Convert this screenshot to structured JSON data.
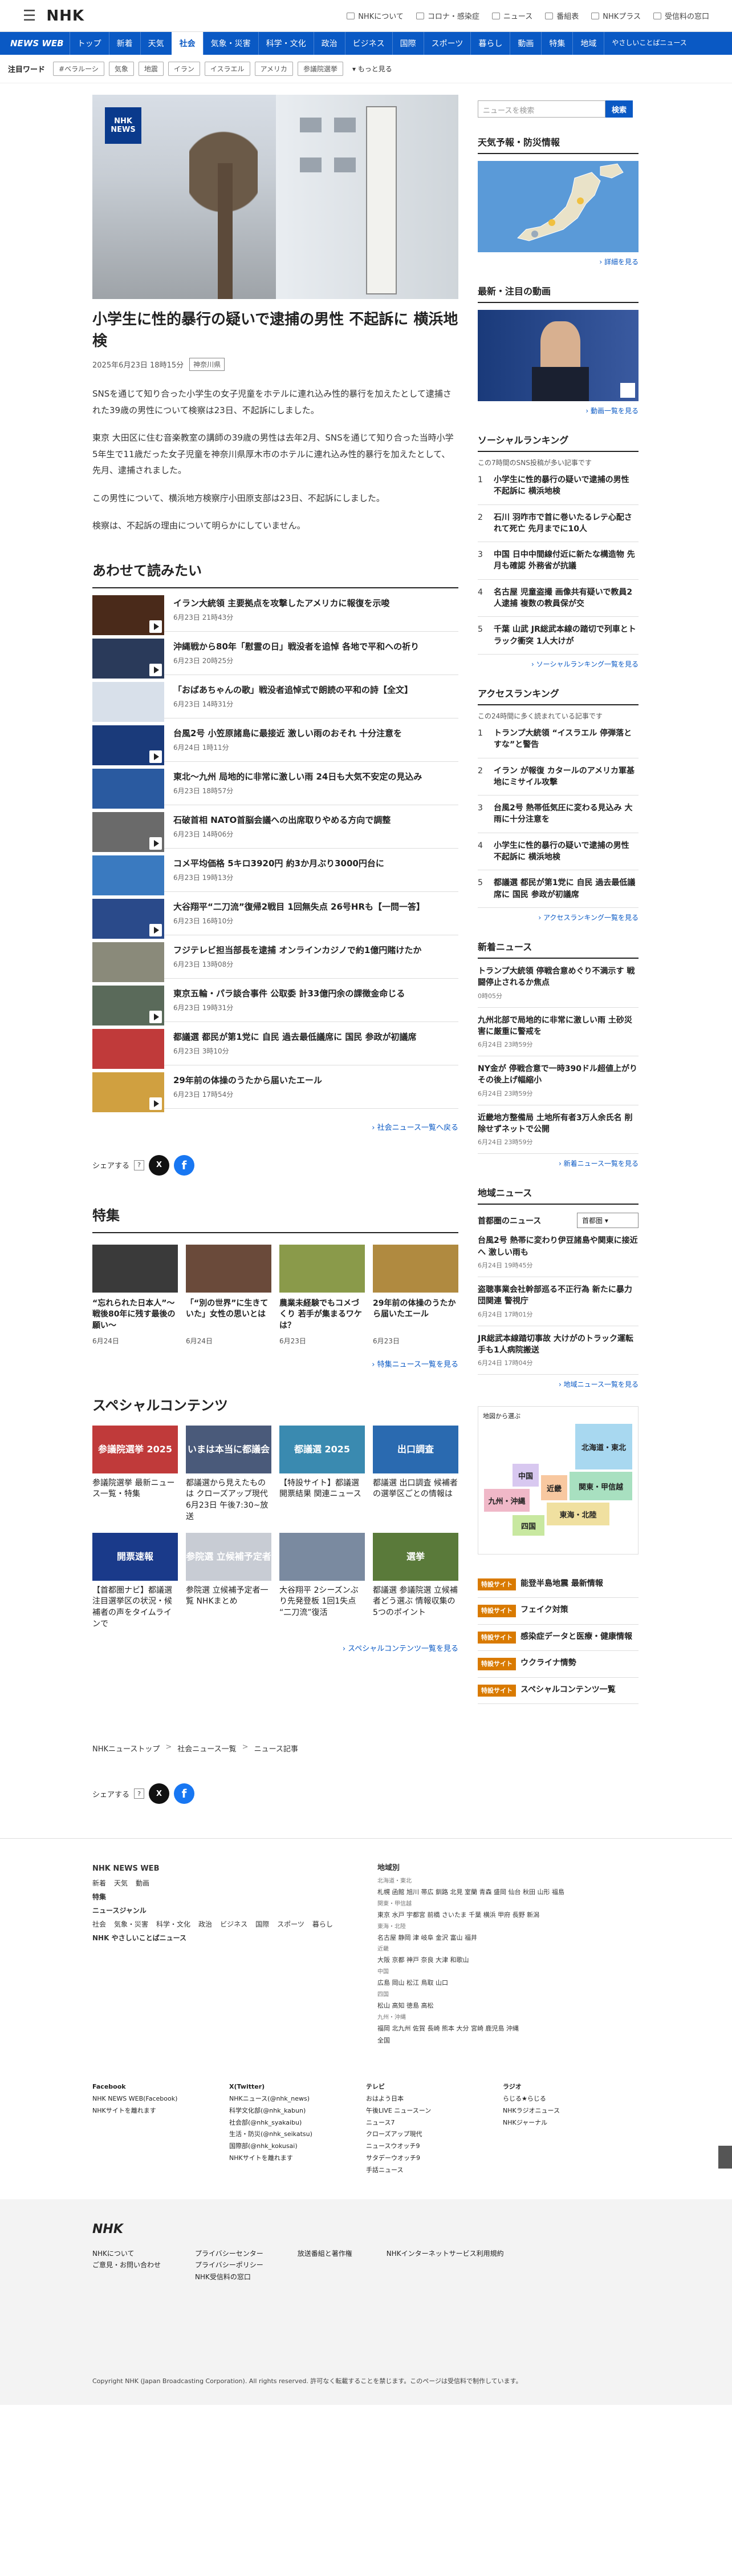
{
  "header": {
    "logo": "NHK",
    "links": [
      "NHKについて",
      "コロナ・感染症",
      "ニュース",
      "番組表",
      "NHKプラス",
      "受信料の窓口"
    ]
  },
  "nav": {
    "brand": "NEWS WEB",
    "items": [
      "トップ",
      "新着",
      "天気",
      "社会",
      "気象・災害",
      "科学・文化",
      "政治",
      "ビジネス",
      "国際",
      "スポーツ",
      "暮らし",
      "動画",
      "特集",
      "地域"
    ],
    "easy": "やさしいことばニュース",
    "active": "社会"
  },
  "trend": {
    "label": "注目ワード",
    "tags": [
      "#ベラルーシ",
      "気象",
      "地震",
      "イラン",
      "イスラエル",
      "アメリカ",
      "参議院選挙"
    ],
    "more": "もっと見る"
  },
  "article": {
    "badge": [
      "NHK",
      "NEWS"
    ],
    "title": "小学生に性的暴行の疑いで逮捕の男性 不起訴に 横浜地検",
    "date": "2025年6月23日 18時15分",
    "chip": "神奈川県",
    "paragraphs": [
      "SNSを通じて知り合った小学生の女子児童をホテルに連れ込み性的暴行を加えたとして逮捕された39歳の男性について検察は23日、不起訴にしました。",
      "東京 大田区に住む音楽教室の講師の39歳の男性は去年2月、SNSを通じて知り合った当時小学5年生で11歳だった女子児童を神奈川県厚木市のホテルに連れ込み性的暴行を加えたとして、先月、逮捕されました。",
      "この男性について、横浜地方検察庁小田原支部は23日、不起訴にしました。",
      "検察は、不起訴の理由について明らかにしていません。"
    ]
  },
  "related": {
    "heading": "あわせて読みたい",
    "items": [
      {
        "t": "イラン大統領 主要拠点を攻撃したアメリカに報復を示唆",
        "d": "6月23日 21時43分",
        "c": "#4a2a1a"
      },
      {
        "t": "沖縄戦から80年「慰霊の日」戦没者を追悼 各地で平和への祈り",
        "d": "6月23日 20時25分",
        "c": "#2a3a5a"
      },
      {
        "t": "「おばあちゃんの歌」戦没者追悼式で朗読の平和の詩【全文】",
        "d": "6月23日 14時31分",
        "c": "#d8e0ea"
      },
      {
        "t": "台風2号 小笠原諸島に最接近 激しい雨のおそれ 十分注意を",
        "d": "6月24日 1時11分",
        "c": "#1a3a7a"
      },
      {
        "t": "東北～九州 局地的に非常に激しい雨 24日も大気不安定の見込み",
        "d": "6月23日 18時57分",
        "c": "#2a5aa0"
      },
      {
        "t": "石破首相 NATO首脳会議への出席取りやめる方向で調整",
        "d": "6月23日 14時06分",
        "c": "#6a6a6a"
      },
      {
        "t": "コメ平均価格 5キロ3920円 約3か月ぶり3000円台に",
        "d": "6月23日 19時13分",
        "c": "#3a7ac0"
      },
      {
        "t": "大谷翔平“二刀流”復帰2戦目 1回無失点 26号HRも【一問一答】",
        "d": "6月23日 16時10分",
        "c": "#2a4a8a"
      },
      {
        "t": "フジテレビ担当部長を逮捕 オンラインカジノで約1億円賭けたか",
        "d": "6月23日 13時08分",
        "c": "#8a8a7a"
      },
      {
        "t": "東京五輪・パラ談合事件 公取委 計33億円余の課徴金命じる",
        "d": "6月23日 19時31分",
        "c": "#5a6a5a"
      },
      {
        "t": "都議選 都民が第1党に 自民 過去最低議席に 国民 参政が初議席",
        "d": "6月23日 3時10分",
        "c": "#c03a3a"
      },
      {
        "t": "29年前の体操のうたから届いたエール",
        "d": "6月23日 17時54分",
        "c": "#d0a040"
      }
    ],
    "more": "社会ニュース一覧へ戻る"
  },
  "share": {
    "label": "シェアする",
    "x": "X",
    "fb": "f"
  },
  "features": {
    "heading": "特集",
    "items": [
      {
        "t": "“忘れられた日本人”〜戦後80年に残す最後の願い〜",
        "d": "6月24日",
        "c": "#3a3a3a"
      },
      {
        "t": "「“別の世界”に生きていた」女性の思いとは",
        "d": "6月24日",
        "c": "#6a4a3a"
      },
      {
        "t": "農業未経験でもコメづくり 若手が集まるワケは？",
        "d": "6月23日",
        "c": "#8a9a4a"
      },
      {
        "t": "29年前の体操のうたから届いたエール",
        "d": "6月23日",
        "c": "#b08a40"
      }
    ],
    "more": "特集ニュース一覧を見る"
  },
  "special": {
    "heading": "スペシャルコンテンツ",
    "items": [
      {
        "t": "参議院選挙 最新ニュース一覧・特集",
        "img": "参議院選挙 2025",
        "c": "#c03a3a"
      },
      {
        "t": "都議選から見えたものは クローズアップ現代 6月23日 午後7:30~放送",
        "img": "いまは本当に都議会",
        "c": "#4a5a7a"
      },
      {
        "t": "【特設サイト】都議選 開票結果 関連ニュース",
        "img": "都議選 2025",
        "c": "#3a8ab0"
      },
      {
        "t": "都議選 出口調査 候補者の選挙区ごとの情報は",
        "img": "出口調査",
        "c": "#2a6ab0"
      },
      {
        "t": "【首都圏ナビ】都議選 注目選挙区の状況・候補者の声をタイムラインで",
        "img": "開票速報",
        "c": "#1a3a8a"
      },
      {
        "t": "参院選 立候補予定者一覧 NHKまとめ",
        "img": "参院選 立候補予定者",
        "c": "#c8ccd4"
      },
      {
        "t": "大谷翔平 2シーズンぶり先発登板 1回1失点 “二刀流”復活",
        "img": "",
        "c": "#7a8aa0"
      },
      {
        "t": "都議選 参議院選 立候補者どう選ぶ 情報収集の5つのポイント",
        "img": "選挙",
        "c": "#5a7a3a"
      }
    ],
    "more": "スペシャルコンテンツ一覧を見る"
  },
  "sidebar": {
    "search_placeholder": "ニュースを検索",
    "search_btn": "検索",
    "weather": {
      "h": "天気予報・防災情報",
      "more": "詳細を見る"
    },
    "video": {
      "h": "最新・注目の動画",
      "more": "動画一覧を見る"
    },
    "social": {
      "h": "ソーシャルランキング",
      "note": "この7時間のSNS投稿が多い記事です",
      "items": [
        "小学生に性的暴行の疑いで逮捕の男性 不起訴に 横浜地検",
        "石川 羽咋市で首に巻いたるレテ心配されて死亡 先月までに10人",
        "中国 日中中間線付近に新たな構造物 先月も確認 外務省が抗議",
        "名古屋 児童盗撮 画像共有疑いで教員2人逮捕 複数の教員保が交",
        "千葉 山武 JR総武本線の踏切で列車とトラック衝突 1人大けが"
      ],
      "more": "ソーシャルランキング一覧を見る"
    },
    "access": {
      "h": "アクセスランキング",
      "note": "この24時間に多く読まれている記事です",
      "items": [
        "トランプ大統領 “イスラエル 停弾落とすな”と警告",
        "イラン が報復 カタールのアメリカ軍基地にミサイル攻撃",
        "台風2号 熱帯低気圧に変わる見込み 大雨に十分注意を",
        "小学生に性的暴行の疑いで逮捕の男性 不起訴に 横浜地検",
        "都議選 都民が第1党に 自民 過去最低議席に 国民 参政が初議席"
      ],
      "more": "アクセスランキング一覧を見る"
    },
    "latest": {
      "h": "新着ニュース",
      "items": [
        {
          "t": "トランプ大統領 停戦合意めぐり不満示す 戦闘停止されるか焦点",
          "d": "0時05分"
        },
        {
          "t": "九州北部で局地的に非常に激しい雨 土砂災害に厳重に警戒を",
          "d": "6月24日 23時59分"
        },
        {
          "t": "NY金が 停戦合意で一時390ドル超値上がり その後上げ幅縮小",
          "d": "6月24日 23時59分"
        },
        {
          "t": "近畿地方整備局 土地所有者3万人余氏名 削除せずネットで公開",
          "d": "6月24日 23時59分"
        }
      ],
      "more": "新着ニュース一覧を見る"
    },
    "regional": {
      "h": "地域ニュース",
      "label": "首都圏のニュース",
      "select": "首都圏",
      "items": [
        {
          "t": "台風2号 熱帯に変わり伊豆諸島や関東に接近へ 激しい雨も",
          "d": "6月24日 19時45分"
        },
        {
          "t": "盗聴事業会社幹部巡る不正行為 新たに暴力団関連 警視庁",
          "d": "6月24日 17時01分"
        },
        {
          "t": "JR総武本線踏切事故 大けがのトラック運転手も1人病院搬送",
          "d": "6月24日 17時04分"
        }
      ],
      "more": "地域ニュース一覧を見る"
    },
    "map": {
      "h": "地図から選ぶ",
      "regions": [
        "北海道・東北",
        "関東・甲信越",
        "東海・北陸",
        "近畿",
        "中国",
        "九州・沖縄",
        "四国"
      ]
    },
    "promo": [
      {
        "tag": "特設サイト",
        "t": "能登半島地震 最新情報"
      },
      {
        "tag": "特設サイト",
        "t": "フェイク対策"
      },
      {
        "tag": "特設サイト",
        "t": "感染症データと医療・健康情報"
      },
      {
        "tag": "特設サイト",
        "t": "ウクライナ情勢"
      },
      {
        "tag": "特設サイト",
        "t": "スペシャルコンテンツ一覧"
      }
    ]
  },
  "breadcrumb": [
    "NHKニューストップ",
    "社会ニュース一覧",
    "ニュース記事"
  ],
  "footer": {
    "brand": "NHK NEWS WEB",
    "cols": [
      "新着",
      "天気",
      "動画",
      "特集",
      "ニュースジャンル",
      "社会",
      "気象・災害",
      "科学・文化",
      "政治",
      "ビジネス",
      "国際",
      "スポーツ",
      "暮らし",
      "NHK やさしいことばニュース"
    ],
    "areas_h": "地域別",
    "areas": [
      "北海道・東北",
      "札幌 函館 旭川 帯広 釧路 北見 室蘭 青森 盛岡 仙台 秋田 山形 福島",
      "関東・甲信越",
      "東京 水戸 宇都宮 前橋 さいたま 千葉 横浜 甲府 長野 新潟",
      "東海・北陸",
      "名古屋 静岡 津 岐阜 金沢 富山 福井",
      "近畿",
      "大阪 京都 神戸 奈良 大津 和歌山",
      "中国",
      "広島 岡山 松江 鳥取 山口",
      "四国",
      "松山 高知 徳島 高松",
      "九州・沖縄",
      "福岡 北九州 佐賀 長崎 熊本 大分 宮崎 鹿児島 沖縄",
      "全国"
    ],
    "sns": [
      {
        "h": "Facebook",
        "l": [
          "NHK NEWS WEB(Facebook)",
          "NHKサイトを離れます"
        ]
      },
      {
        "h": "X(Twitter)",
        "l": [
          "NHKニュース(@nhk_news)",
          "科学文化部(@nhk_kabun)",
          "社会部(@nhk_syakaibu)",
          "生活・防災(@nhk_seikatsu)",
          "国際部(@nhk_kokusai)",
          "NHKサイトを離れます"
        ]
      },
      {
        "h": "テレビ",
        "l": [
          "おはよう日本",
          "午後LIVE ニュースーン",
          "ニュース7",
          "クローズアップ現代",
          "ニュースウオッチ9",
          "サタデーウオッチ9",
          "手話ニュース"
        ]
      },
      {
        "h": "ラジオ",
        "l": [
          "らじる★らじる",
          "NHKラジオニュース",
          "NHKジャーナル"
        ]
      }
    ],
    "bottom_links": [
      [
        "NHKについて",
        "ご意見・お問い合わせ"
      ],
      [
        "プライバシーセンター",
        "プライバシーポリシー",
        "NHK受信料の窓口"
      ],
      [
        "放送番組と著作権"
      ],
      [
        "NHKインターネットサービス利用規約"
      ]
    ],
    "copyright": "Copyright NHK (Japan Broadcasting Corporation). All rights reserved. 許可なく転載することを禁じます。このページは受信料で制作しています。"
  }
}
